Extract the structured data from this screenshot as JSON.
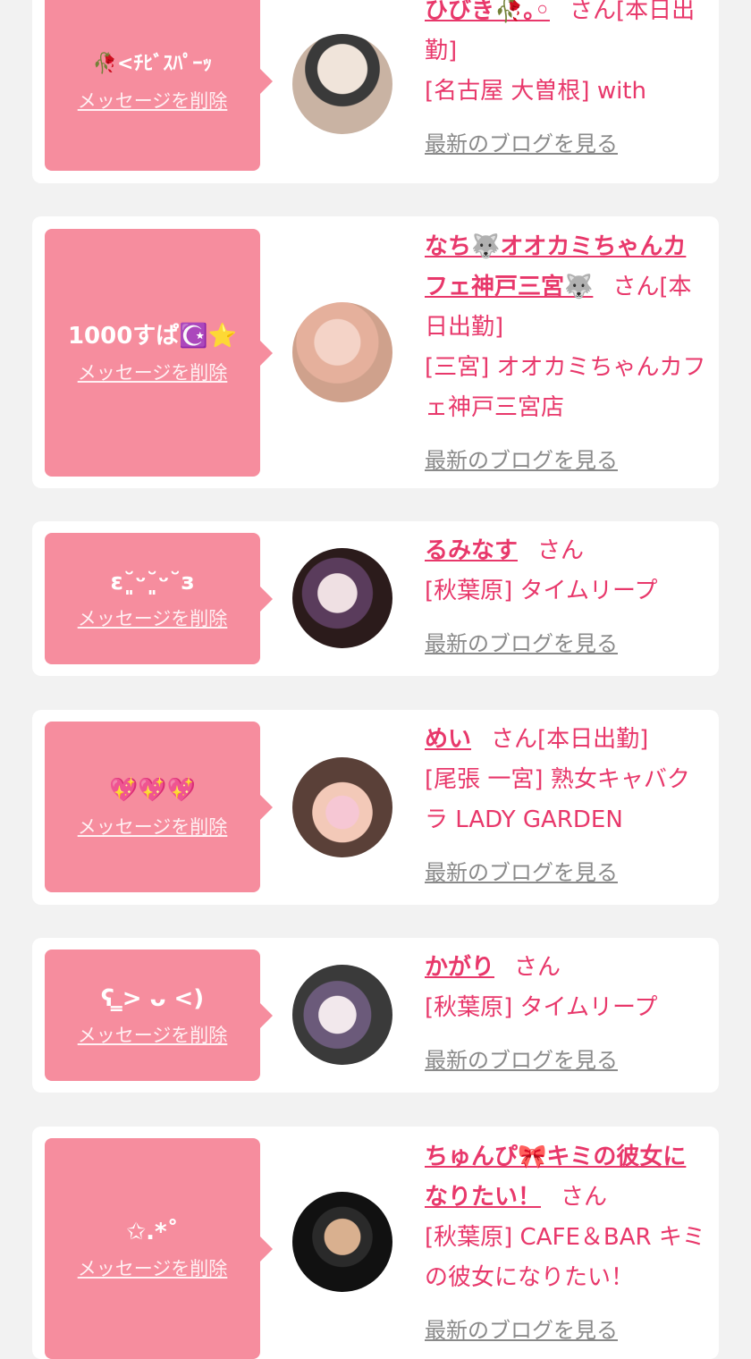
{
  "cards": [
    {
      "message": "🥀<ﾁﾋﾞｽﾊﾟｰｯ",
      "delete_label": "メッセージを削除",
      "name": "ひびき🥀｡◦",
      "san": "さん",
      "status": "[本日出勤]",
      "shop": "[名古屋 大曽根] with",
      "blog_label": "最新のブログを見る",
      "avatar_bg": [
        "#e8ddd4",
        "#3a3a3a",
        "#c9b3a3"
      ]
    },
    {
      "message": "1000すぱ☪️⭐",
      "delete_label": "メッセージを削除",
      "name": "なち🐺オオカミちゃんカフェ神戸三宮🐺",
      "san": "さん",
      "status": "[本日出勤]",
      "shop": "[三宮] オオカミちゃんカフェ神戸三宮店",
      "blog_label": "最新のブログを見る",
      "avatar_bg": [
        "#f7dfe6",
        "#e9b8a6",
        "#d6a590"
      ]
    },
    {
      "message": "ε˘͈ᵕ˘͈ᵕ˘з",
      "delete_label": "メッセージを削除",
      "name": "るみなす",
      "san": "さん",
      "status": "",
      "shop": "[秋葉原] タイムリープ",
      "blog_label": "最新のブログを見る",
      "avatar_bg": [
        "#2b1b1b",
        "#5a3c5c",
        "#e7d6d9"
      ]
    },
    {
      "message": "💖💖💖",
      "delete_label": "メッセージを削除",
      "name": "めい",
      "san": "さん",
      "status": "[本日出勤]",
      "shop": "[尾張 一宮] 熟女キャバクラ LADY GARDEN",
      "blog_label": "最新のブログを見る",
      "avatar_bg": [
        "#5a4038",
        "#c79a82",
        "#f3c9b8"
      ]
    },
    {
      "message": "ʕ ̳> ᴗ <)",
      "delete_label": "メッセージを削除",
      "name": "かがり",
      "san": "さん",
      "status": "",
      "shop": "[秋葉原] タイムリープ",
      "blog_label": "最新のブログを見る",
      "avatar_bg": [
        "#3a3a3a",
        "#6b5a7a",
        "#efe7ea"
      ]
    },
    {
      "message": "✩.*˚",
      "delete_label": "メッセージを削除",
      "name": "ちゅんぴ🎀キミの彼女になりたい！",
      "san": "さん",
      "status": "",
      "shop": "[秋葉原] CAFE＆BAR キミの彼女になりたい！",
      "blog_label": "最新のブログを見る",
      "avatar_bg": [
        "#111111",
        "#2a2a2a",
        "#c99e80"
      ]
    }
  ]
}
